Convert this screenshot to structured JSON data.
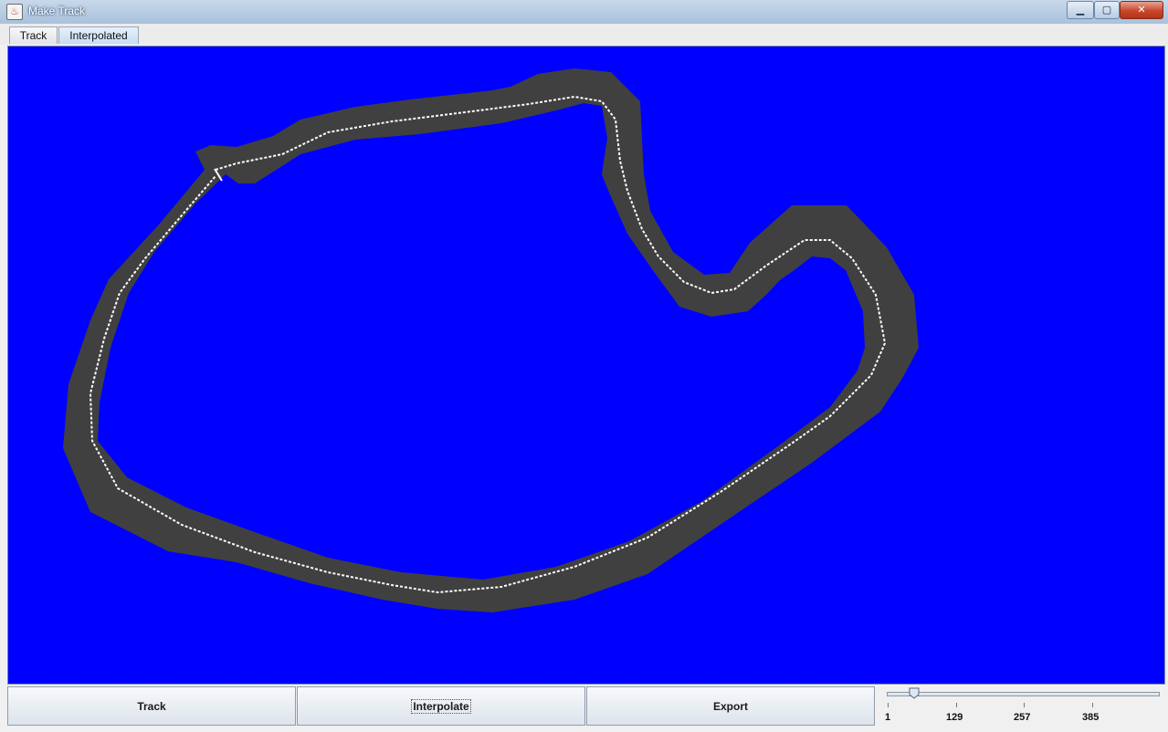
{
  "window": {
    "title": "Make Track",
    "minimize_glyph": "▁",
    "maximize_glyph": "▢",
    "close_glyph": "✕",
    "app_icon": "java-cup-icon",
    "app_icon_glyph": "♨"
  },
  "tabs": [
    {
      "label": "Track",
      "selected": false
    },
    {
      "label": "Interpolated",
      "selected": true
    }
  ],
  "canvas": {
    "background_color": "#0000ff",
    "track_surface_color": "#404040",
    "centerline_color": "#ffffff"
  },
  "buttons": {
    "track": "Track",
    "interpolate": "Interpolate",
    "export": "Export"
  },
  "slider": {
    "min": 1,
    "value": 26,
    "tick_labels": [
      "1",
      "129",
      "257",
      "385"
    ]
  }
}
